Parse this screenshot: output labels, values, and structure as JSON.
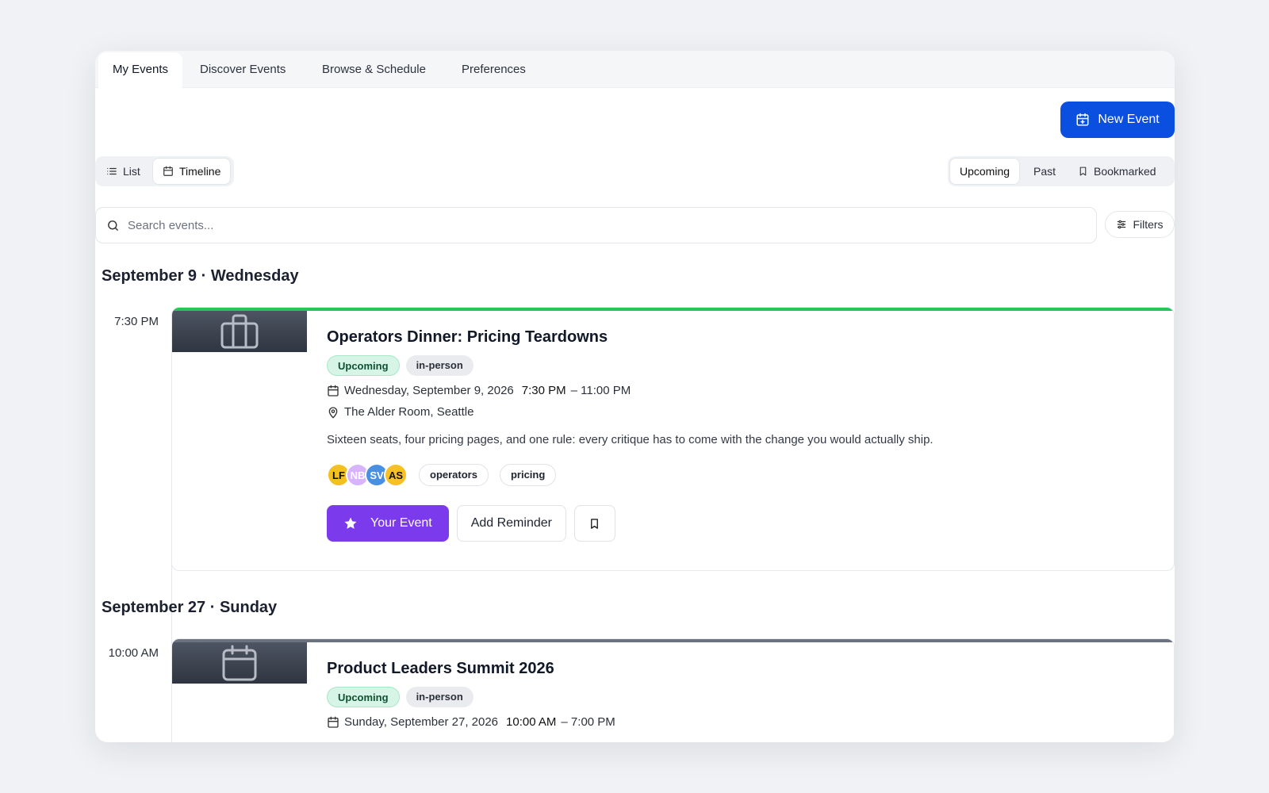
{
  "tabs": [
    "My Events",
    "Discover Events",
    "Browse & Schedule",
    "Preferences"
  ],
  "toolbar": {
    "new_event_label": "New Event"
  },
  "view_toggle": {
    "list": "List",
    "timeline": "Timeline",
    "active": "Timeline"
  },
  "filter_toggle": {
    "upcoming": "Upcoming",
    "past": "Past",
    "bookmarked": "Bookmarked",
    "active": "Upcoming"
  },
  "search": {
    "placeholder": "Search events..."
  },
  "filters_label": "Filters",
  "groups": [
    {
      "date_heading": "September 9 · Wednesday",
      "event": {
        "time": "7:30 PM",
        "title": "Operators Dinner: Pricing Teardowns",
        "status_badge": "Upcoming",
        "mode_badge": "in-person",
        "date_text": "Wednesday, September 9, 2026",
        "start": "7:30 PM",
        "end": "– 11:00 PM",
        "location": "The Alder Room, Seattle",
        "description": "Sixteen seats, four pricing pages, and one rule: every critique has to come with the change you would actually ship.",
        "attendees": [
          {
            "initials": "LF",
            "bg": "#f4c020",
            "fg": "#111111"
          },
          {
            "initials": "NB",
            "bg": "#d8b4fe",
            "fg": "#ffffff"
          },
          {
            "initials": "SV",
            "bg": "#4a90e2",
            "fg": "#ffffff"
          },
          {
            "initials": "AS",
            "bg": "#f6c026",
            "fg": "#111111"
          }
        ],
        "tags": [
          "operators",
          "pricing"
        ],
        "primary_action": "Your Event",
        "secondary_action": "Add Reminder",
        "accent": "#22c55e",
        "thumb_icon": "briefcase-icon"
      }
    },
    {
      "date_heading": "September 27 · Sunday",
      "event": {
        "time": "10:00 AM",
        "title": "Product Leaders Summit 2026",
        "status_badge": "Upcoming",
        "mode_badge": "in-person",
        "date_text": "Sunday, September 27, 2026",
        "start": "10:00 AM",
        "end": "– 7:00 PM",
        "accent": "#6b7280",
        "thumb_icon": "calendar-icon"
      }
    }
  ],
  "colors": {
    "primary": "#0b4fe0",
    "purple": "#7c3aed",
    "green": "#22c55e"
  }
}
